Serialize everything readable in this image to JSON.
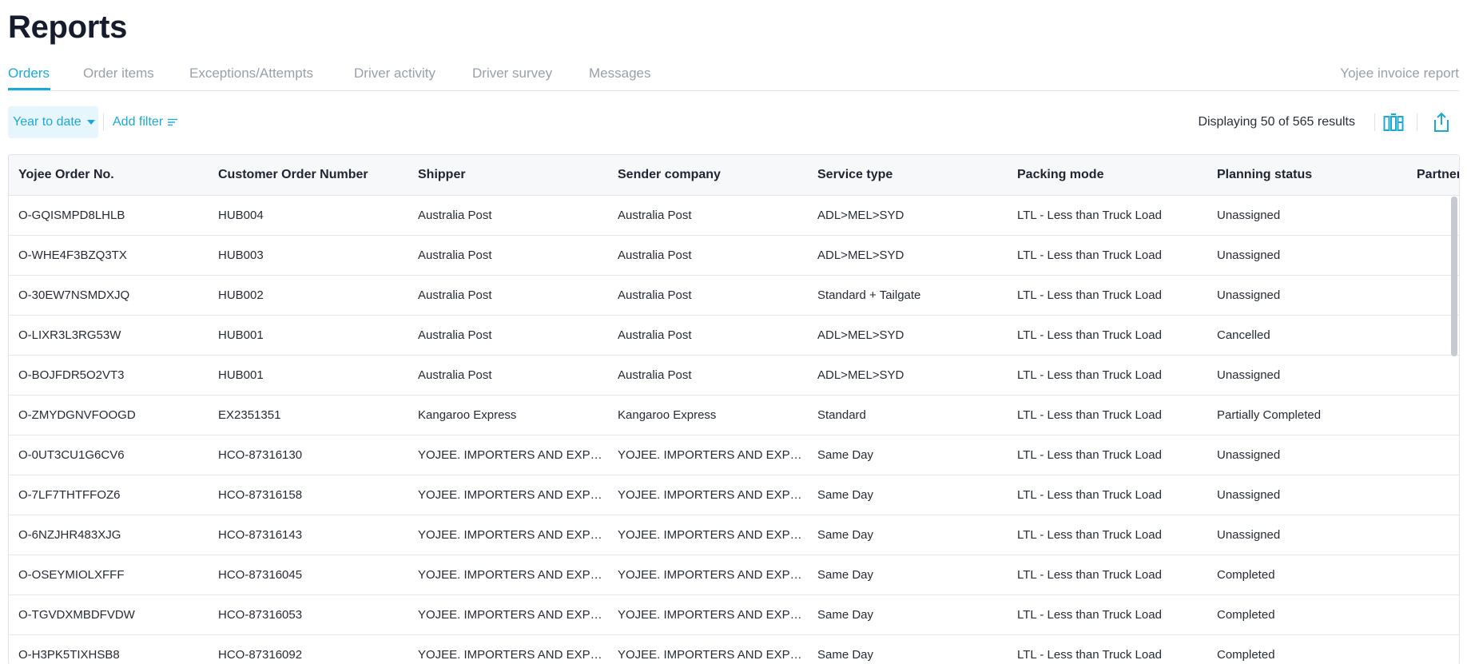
{
  "page": {
    "title": "Reports"
  },
  "tabs": [
    {
      "label": "Orders",
      "active": true
    },
    {
      "label": "Order items"
    },
    {
      "label": "Exceptions/Attempts"
    },
    {
      "label": "Driver activity"
    },
    {
      "label": "Driver survey"
    },
    {
      "label": "Messages"
    }
  ],
  "right_tab": {
    "label": "Yojee invoice report"
  },
  "filters": {
    "date_range": "Year to date",
    "add_filter": "Add filter",
    "results": "Displaying 50 of 565 results"
  },
  "icons": {
    "columns": "columns-icon",
    "export": "export-icon",
    "filter": "filter-lines-icon",
    "caret": "chevron-down-icon"
  },
  "colors": {
    "accent": "#1ba9d8",
    "accent_bg": "#e6f6fc",
    "title": "#161b2e"
  },
  "table": {
    "columns": [
      "Yojee Order No.",
      "Customer Order Number",
      "Shipper",
      "Sender company",
      "Service type",
      "Packing mode",
      "Planning status",
      "Partner"
    ],
    "rows": [
      [
        "O-GQISMPD8LHLB",
        "HUB004",
        "Australia Post",
        "Australia Post",
        "ADL>MEL>SYD",
        "LTL - Less than Truck Load",
        "Unassigned",
        ""
      ],
      [
        "O-WHE4F3BZQ3TX",
        "HUB003",
        "Australia Post",
        "Australia Post",
        "ADL>MEL>SYD",
        "LTL - Less than Truck Load",
        "Unassigned",
        ""
      ],
      [
        "O-30EW7NSMDXJQ",
        "HUB002",
        "Australia Post",
        "Australia Post",
        "Standard + Tailgate",
        "LTL - Less than Truck Load",
        "Unassigned",
        ""
      ],
      [
        "O-LIXR3L3RG53W",
        "HUB001",
        "Australia Post",
        "Australia Post",
        "ADL>MEL>SYD",
        "LTL - Less than Truck Load",
        "Cancelled",
        ""
      ],
      [
        "O-BOJFDR5O2VT3",
        "HUB001",
        "Australia Post",
        "Australia Post",
        "ADL>MEL>SYD",
        "LTL - Less than Truck Load",
        "Unassigned",
        ""
      ],
      [
        "O-ZMYDGNVFOOGD",
        "EX2351351",
        "Kangaroo Express",
        "Kangaroo Express",
        "Standard",
        "LTL - Less than Truck Load",
        "Partially Completed",
        ""
      ],
      [
        "O-0UT3CU1G6CV6",
        "HCO-87316130",
        "YOJEE. IMPORTERS AND EXPORTERS",
        "YOJEE. IMPORTERS AND EXPORTERS",
        "Same Day",
        "LTL - Less than Truck Load",
        "Unassigned",
        ""
      ],
      [
        "O-7LF7THTFFOZ6",
        "HCO-87316158",
        "YOJEE. IMPORTERS AND EXPORTERS",
        "YOJEE. IMPORTERS AND EXPORTERS",
        "Same Day",
        "LTL - Less than Truck Load",
        "Unassigned",
        ""
      ],
      [
        "O-6NZJHR483XJG",
        "HCO-87316143",
        "YOJEE. IMPORTERS AND EXPORTERS",
        "YOJEE. IMPORTERS AND EXPORTERS",
        "Same Day",
        "LTL - Less than Truck Load",
        "Unassigned",
        ""
      ],
      [
        "O-OSEYMIOLXFFF",
        "HCO-87316045",
        "YOJEE. IMPORTERS AND EXPORTERS",
        "YOJEE. IMPORTERS AND EXPORTERS",
        "Same Day",
        "LTL - Less than Truck Load",
        "Completed",
        ""
      ],
      [
        "O-TGVDXMBDFVDW",
        "HCO-87316053",
        "YOJEE. IMPORTERS AND EXPORTERS",
        "YOJEE. IMPORTERS AND EXPORTERS",
        "Same Day",
        "LTL - Less than Truck Load",
        "Completed",
        ""
      ],
      [
        "O-H3PK5TIXHSB8",
        "HCO-87316092",
        "YOJEE. IMPORTERS AND EXPORTERS",
        "YOJEE. IMPORTERS AND EXPORTERS",
        "Same Day",
        "LTL - Less than Truck Load",
        "Completed",
        ""
      ]
    ]
  }
}
